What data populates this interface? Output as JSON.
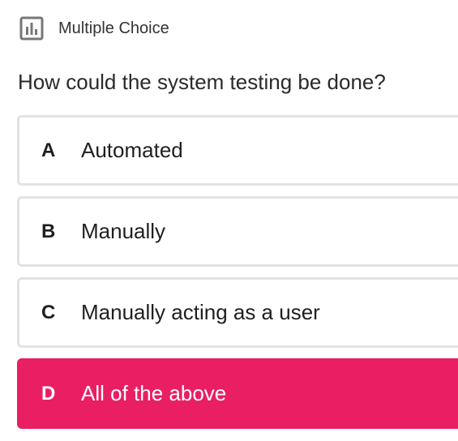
{
  "header": {
    "icon": "bar-chart-icon",
    "label": "Multiple Choice"
  },
  "question": "How could the system testing be done?",
  "options": [
    {
      "letter": "A",
      "text": "Automated",
      "selected": false
    },
    {
      "letter": "B",
      "text": "Manually",
      "selected": false
    },
    {
      "letter": "C",
      "text": "Manually acting as a user",
      "selected": false
    },
    {
      "letter": "D",
      "text": "All of the above",
      "selected": true
    }
  ],
  "colors": {
    "selected_background": "#e91e63",
    "option_border": "#e2e2e2",
    "icon_stroke": "#777777"
  }
}
